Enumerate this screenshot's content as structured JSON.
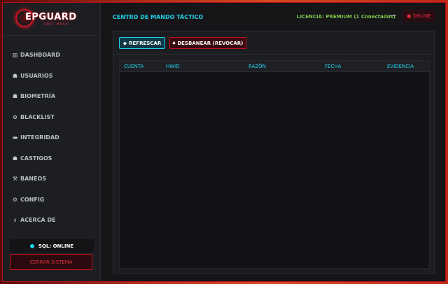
{
  "app": {
    "logo_text": "EPGUARD",
    "logo_sub": "ANTI-HACK"
  },
  "sidebar": {
    "items": [
      {
        "label": "DASHBOARD",
        "icon": "dashboard-icon",
        "glyph": "▥"
      },
      {
        "label": "USUARIOS",
        "icon": "users-icon",
        "glyph": "☗"
      },
      {
        "label": "BIOMETRÍA",
        "icon": "biometrics-icon",
        "glyph": "☗"
      },
      {
        "label": "BLACKLIST",
        "icon": "ban-icon",
        "glyph": "⊘"
      },
      {
        "label": "INTEGRIDAD",
        "icon": "integrity-icon",
        "glyph": "▬"
      },
      {
        "label": "CASTIGOS",
        "icon": "punishments-icon",
        "glyph": "☗"
      },
      {
        "label": "BANEOS",
        "icon": "hammer-icon",
        "glyph": "⚒"
      },
      {
        "label": "CONFIG",
        "icon": "gear-icon",
        "glyph": "⚙"
      },
      {
        "label": "ACERCA DE",
        "icon": "info-icon",
        "glyph": "ı"
      }
    ],
    "sql_status": "SQL: ONLINE",
    "logout_label": "CERRAR SISTEMA"
  },
  "header": {
    "title": "CENTRO DE MANDO TÁCTICO",
    "license": "LICENCIA: PREMIUM (1 Conectados)",
    "minimize": "—",
    "online_badge": "● ONLINE"
  },
  "toolbar": {
    "refresh_label": "REFRESCAR",
    "unban_label": "DESBANEAR (REVOCAR)"
  },
  "table": {
    "columns": [
      "CUENTA",
      "HWID",
      "RAZÓN",
      "FECHA",
      "EVIDENCIA"
    ],
    "rows": []
  },
  "colors": {
    "accent_cyan": "#22d3ee",
    "accent_red": "#c8121f",
    "license_green": "#7cc84a"
  }
}
